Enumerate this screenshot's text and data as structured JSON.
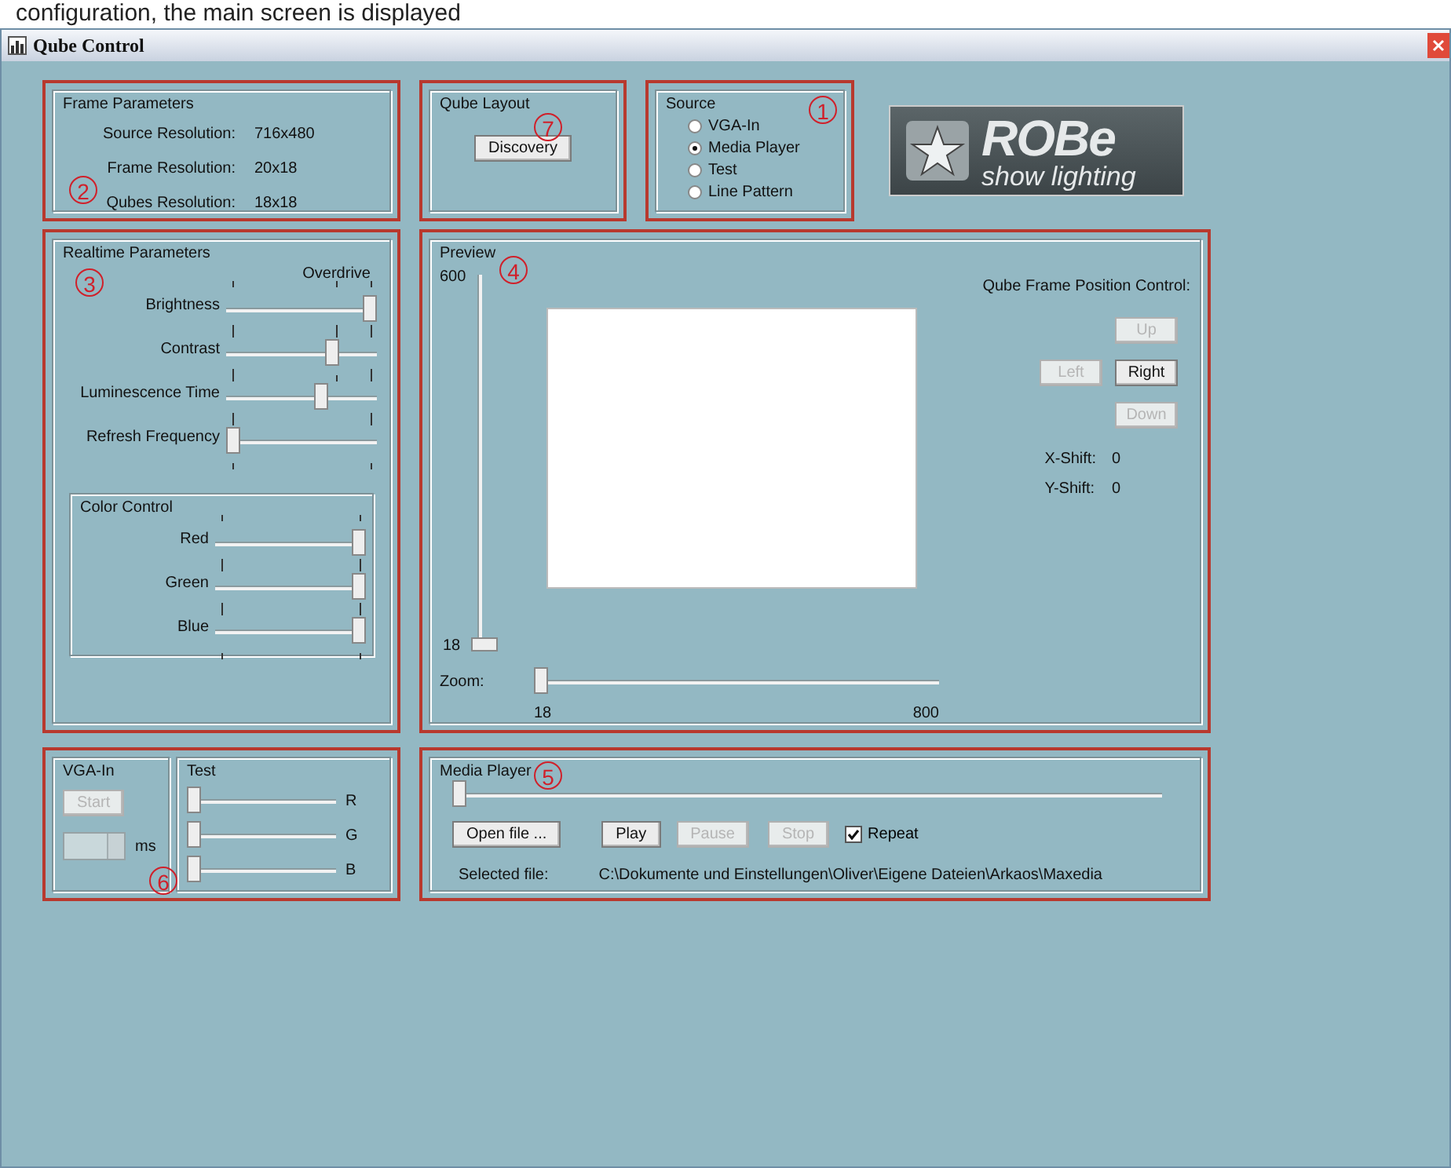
{
  "document_text": "configuration, the main screen is displayed",
  "window": {
    "title": "Qube Control"
  },
  "frame_parameters": {
    "title": "Frame Parameters",
    "callout": "2",
    "rows": [
      {
        "label": "Source Resolution:",
        "value": "716x480"
      },
      {
        "label": "Frame Resolution:",
        "value": "20x18"
      },
      {
        "label": "Qubes Resolution:",
        "value": "18x18"
      }
    ]
  },
  "qube_layout": {
    "title": "Qube Layout",
    "callout": "7",
    "button": "Discovery"
  },
  "source": {
    "title": "Source",
    "callout": "1",
    "options": [
      {
        "label": "VGA-In",
        "selected": false
      },
      {
        "label": "Media Player",
        "selected": true
      },
      {
        "label": "Test",
        "selected": false
      },
      {
        "label": "Line Pattern",
        "selected": false
      }
    ]
  },
  "logo": {
    "brand": "ROBe",
    "tagline": "show lighting"
  },
  "realtime": {
    "title": "Realtime Parameters",
    "callout": "3",
    "overdrive_label": "Overdrive",
    "sliders": [
      {
        "label": "Brightness",
        "level": 1
      },
      {
        "label": "Contrast",
        "level": 0.72
      },
      {
        "label": "Luminescence Time",
        "level": 0.64
      },
      {
        "label": "Refresh Frequency",
        "level": 0
      }
    ],
    "color_control": {
      "title": "Color Control",
      "sliders": [
        {
          "label": "Red",
          "level": 1
        },
        {
          "label": "Green",
          "level": 1
        },
        {
          "label": "Blue",
          "level": 1
        }
      ]
    }
  },
  "preview": {
    "title": "Preview",
    "callout": "4",
    "vertical_max": "600",
    "vertical_min": "18",
    "vertical_slider": {
      "level": 0
    },
    "zoom_label": "Zoom:",
    "zoom_min": "18",
    "zoom_max": "800",
    "zoom_slider": {
      "level": 0
    },
    "position_control": {
      "title": "Qube Frame Position Control:",
      "buttons": [
        {
          "label": "Up",
          "disabled": true
        },
        {
          "label": "Left",
          "disabled": true
        },
        {
          "label": "Right",
          "disabled": false
        },
        {
          "label": "Down",
          "disabled": true
        }
      ],
      "shifts": [
        {
          "label": "X-Shift:",
          "value": "0"
        },
        {
          "label": "Y-Shift:",
          "value": "0"
        }
      ]
    }
  },
  "vga_in": {
    "title": "VGA-In",
    "callout": "6",
    "start": {
      "label": "Start",
      "disabled": true
    },
    "spin_unit": "ms",
    "spin_disabled": true
  },
  "test": {
    "title": "Test",
    "channels": [
      {
        "label": "R",
        "level": 0
      },
      {
        "label": "G",
        "level": 0
      },
      {
        "label": "B",
        "level": 0
      }
    ]
  },
  "media_player": {
    "title": "Media Player",
    "callout": "5",
    "level": 0,
    "buttons": [
      {
        "label": "Open file ...",
        "disabled": false
      },
      {
        "label": "Play",
        "disabled": false
      },
      {
        "label": "Pause",
        "disabled": true
      },
      {
        "label": "Stop",
        "disabled": true
      }
    ],
    "repeat": {
      "label": "Repeat",
      "checked": true
    },
    "selected_file_label": "Selected file:",
    "selected_file": "C:\\Dokumente und Einstellungen\\Oliver\\Eigene Dateien\\Arkaos\\Maxedia"
  }
}
